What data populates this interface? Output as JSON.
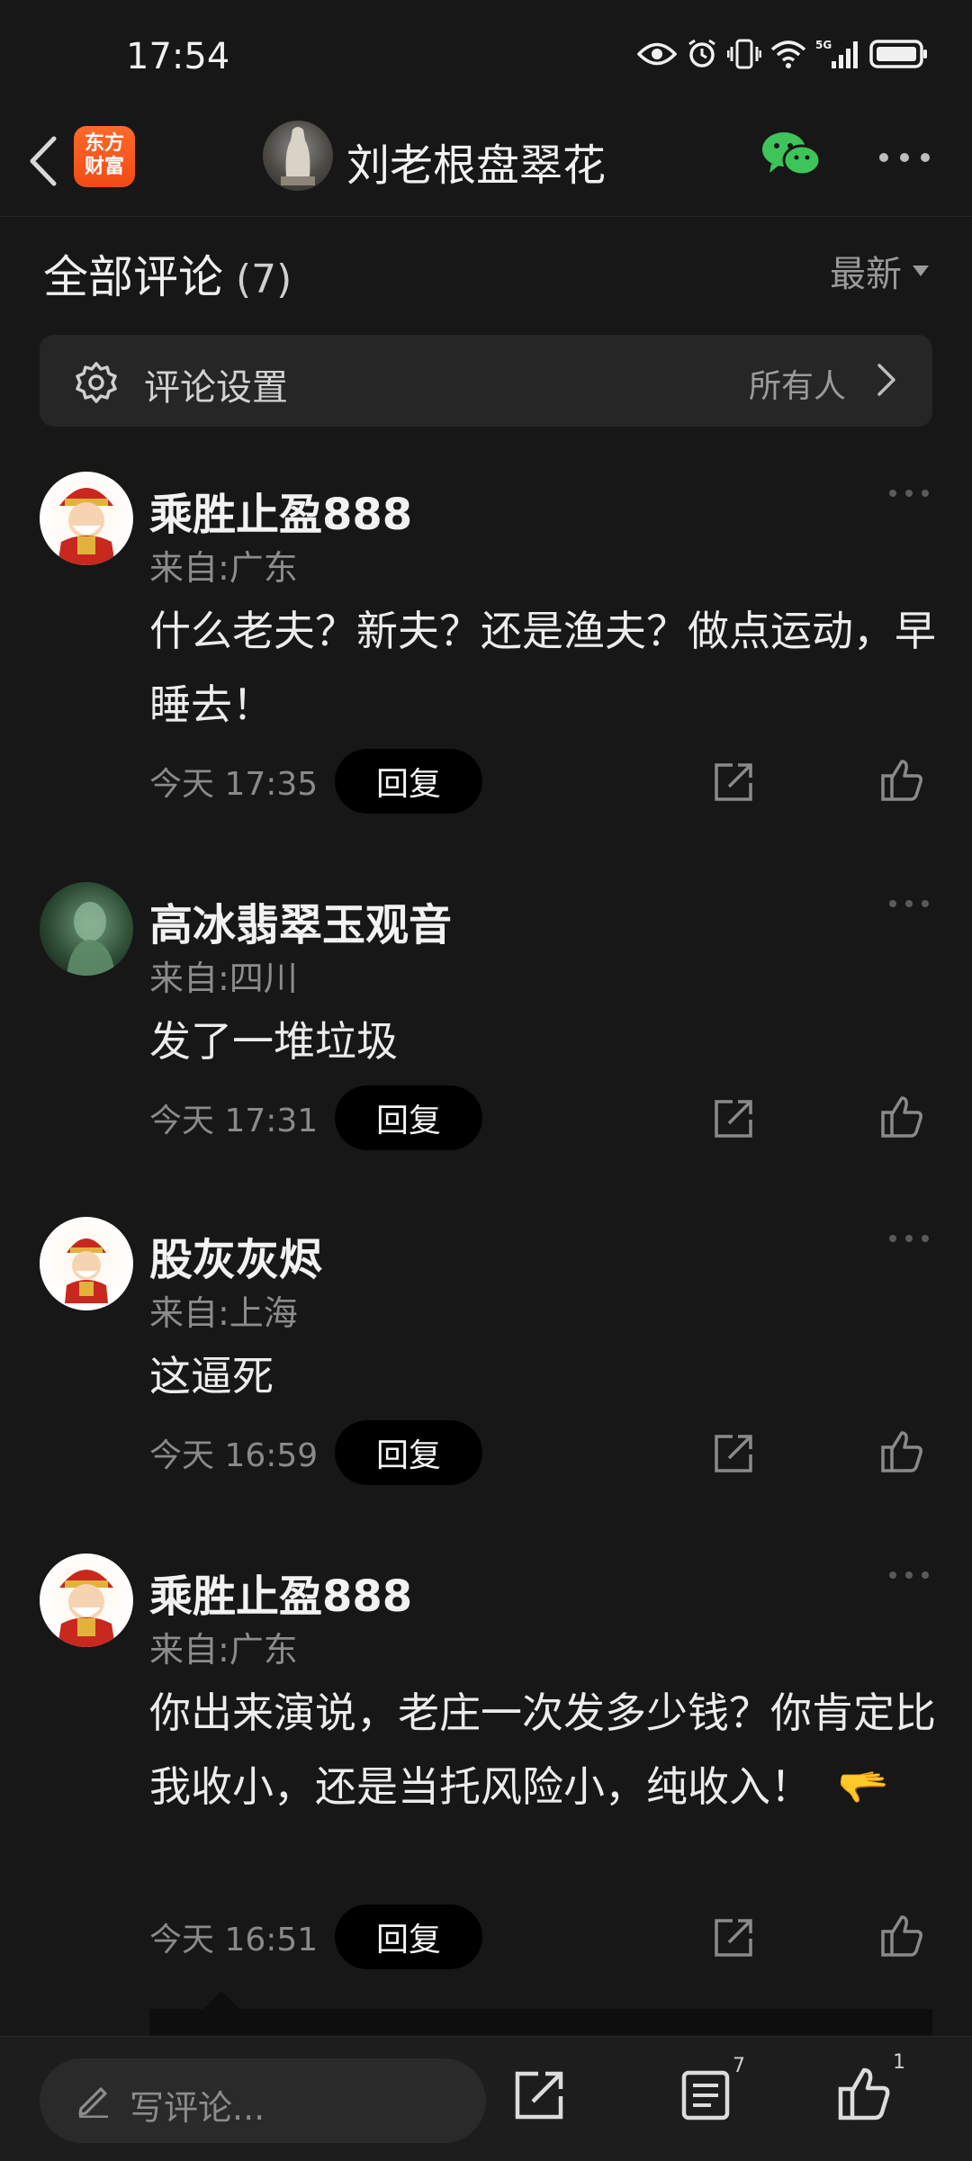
{
  "status_bar": {
    "time": "17:54",
    "network": "5G"
  },
  "header": {
    "app_logo_line1": "东方",
    "app_logo_line2": "财富",
    "profile_name": "刘老根盘翠花"
  },
  "comments_header": {
    "title": "全部评论",
    "count": "(7)",
    "sort": "最新"
  },
  "settings": {
    "label": "评论设置",
    "value": "所有人"
  },
  "reply_label": "回复",
  "comments": [
    {
      "user": "乘胜止盈888",
      "location": "来自:广东",
      "text": "什么老夫？新夫？还是渔夫？做点运动，早睡去！",
      "time": "今天 17:35",
      "avatar": "fortune-god-avatar"
    },
    {
      "user": "高冰翡翠玉观音",
      "location": "来自:四川",
      "text": "发了一堆垃圾",
      "time": "今天 17:31",
      "avatar": "jade-guanyin-avatar"
    },
    {
      "user": "股灰灰烬",
      "location": "来自:上海",
      "text": "这逼死",
      "time": "今天 16:59",
      "avatar": "fortune-god-avatar"
    },
    {
      "user": "乘胜止盈888",
      "location": "来自:广东",
      "text": "你出来演说，老庄一次发多少钱？你肯定比我收小，还是当托风险小，纯收入！",
      "emoji": "🫳",
      "time": "今天 16:51",
      "avatar": "fortune-god-avatar"
    }
  ],
  "bottom_bar": {
    "placeholder": "写评论...",
    "comment_count": "7",
    "like_count": "1"
  },
  "colors": {
    "background": "#171717",
    "accent_logo": "#f24a14",
    "wechat_green": "#3ec45a"
  }
}
